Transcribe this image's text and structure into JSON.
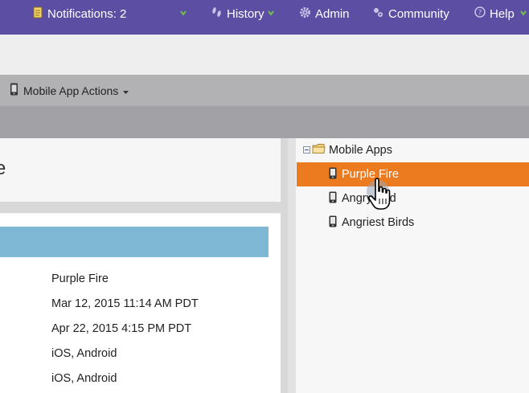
{
  "topnav": {
    "notifications": "Notifications: 2",
    "history": "History",
    "admin": "Admin",
    "community": "Community",
    "help": "Help"
  },
  "toolbar": {
    "mobile_app_actions": "Mobile App Actions"
  },
  "page": {
    "title_fragment": "e"
  },
  "details": {
    "values": [
      "Purple Fire",
      "Mar 12, 2015 11:14 AM PDT",
      "Apr 22, 2015 4:15 PM PDT",
      "iOS, Android",
      "iOS, Android"
    ]
  },
  "tree": {
    "root": "Mobile Apps",
    "items": [
      {
        "label": "Purple Fire",
        "selected": true
      },
      {
        "label": "Angry Bird",
        "selected": false
      },
      {
        "label": "Angriest Birds",
        "selected": false
      }
    ]
  },
  "colors": {
    "nav_bg": "#5b4ea3",
    "selected_bg": "#ec7a1e",
    "header_blue": "#7eb8d4",
    "caret_green": "#6fc24a"
  }
}
